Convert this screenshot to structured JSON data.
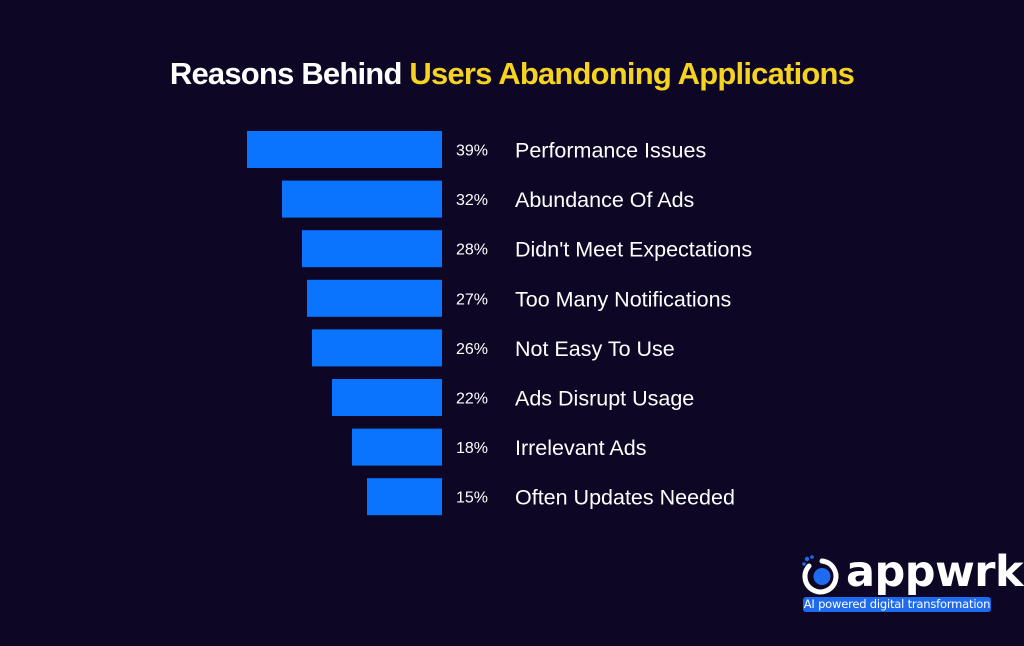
{
  "colors": {
    "background": "#0d0725",
    "bar": "#0b74ff",
    "title_text": "#ffffff",
    "title_accent": "#f5d320",
    "label_text": "#ffffff",
    "brand_blue": "#1f6bf0"
  },
  "title": {
    "part1": "Reasons Behind ",
    "part2": "Users Abandoning Applications"
  },
  "logo": {
    "icon": "appwrk-logo-icon",
    "wordmark": "appwrk",
    "tagline": "AI powered digital transformation"
  },
  "chart_data": {
    "type": "bar",
    "orientation": "horizontal",
    "title": "Reasons Behind Users Abandoning Applications",
    "xlabel": "",
    "ylabel": "",
    "categories": [
      "Performance Issues",
      "Abundance Of Ads",
      "Didn't Meet Expectations",
      "Too Many Notifications",
      "Not Easy To Use",
      "Ads Disrupt Usage",
      "Irrelevant Ads",
      "Often Updates Needed"
    ],
    "values": [
      39,
      32,
      28,
      27,
      26,
      22,
      18,
      15
    ],
    "value_labels": [
      "39%",
      "32%",
      "28%",
      "27%",
      "26%",
      "22%",
      "18%",
      "15%"
    ],
    "unit": "%",
    "grid": false,
    "legend": "none",
    "bar_direction": "bars grow leftward from a common right edge"
  }
}
